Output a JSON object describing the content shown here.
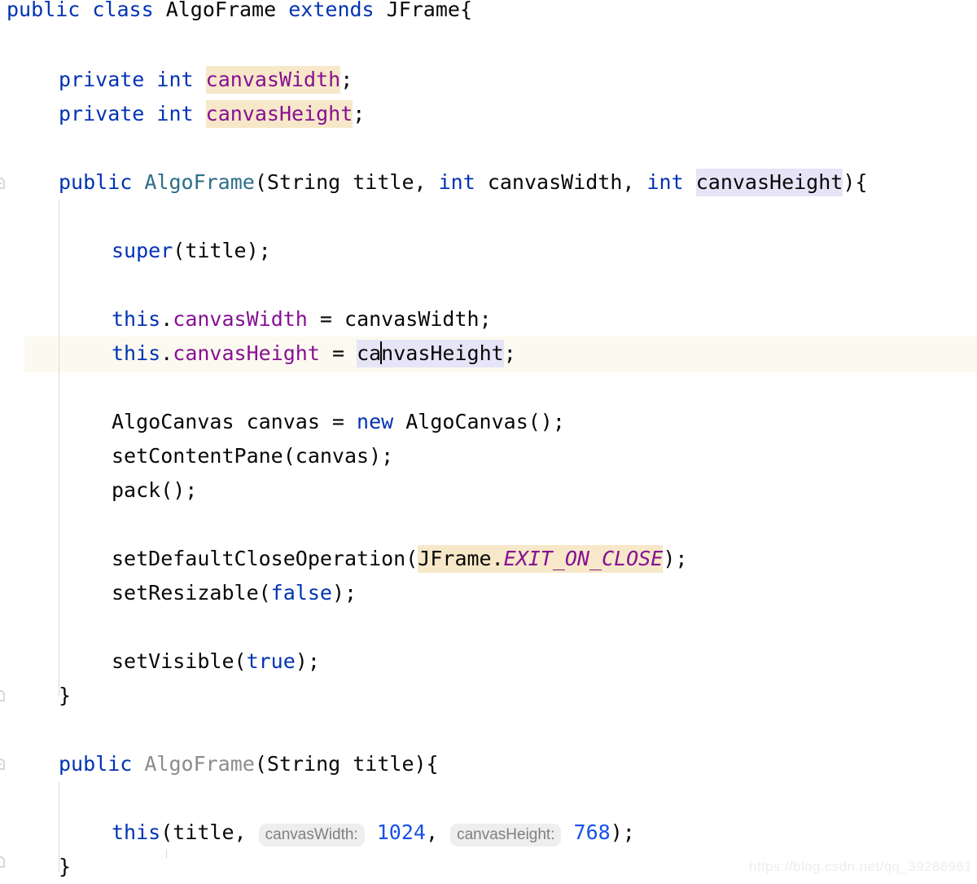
{
  "editor": {
    "app": "IntelliJ IDEA Java Editor",
    "file_language": "Java",
    "theme": "light"
  },
  "colors": {
    "background": "#ffffff",
    "keyword": "#0033b3",
    "field": "#871094",
    "number": "#1750eb",
    "constructor_used": "#2d6e8a",
    "constructor_unused": "#8c8c8c",
    "text": "#080808",
    "identifier_highlight": "#f6e8c8",
    "occurrence_highlight": "#e6e4f7",
    "current_line": "#fcfaf0",
    "indent_guide": "#d9d9d9",
    "hint_background": "#eeeeee",
    "hint_text": "#808080",
    "watermark": "#ededed"
  },
  "code": {
    "line01": {
      "kw_public": "public",
      "kw_class": "class",
      "class_name": "AlgoFrame",
      "kw_extends": "extends",
      "super_class": "JFrame{"
    },
    "line03": {
      "kw_private": "private",
      "kw_int": "int",
      "field": "canvasWidth",
      "semi": ";"
    },
    "line04": {
      "kw_private": "private",
      "kw_int": "int",
      "field": "canvasHeight",
      "semi": ";"
    },
    "line06": {
      "kw_public": "public",
      "ctor_name": "AlgoFrame",
      "open_paren": "(String title, ",
      "kw_int_1": "int",
      "param_1": " canvasWidth, ",
      "kw_int_2": "int",
      "space": " ",
      "param_2": "canvasHeight",
      "close": "){"
    },
    "line08": {
      "kw_super": "super",
      "rest": "(title);"
    },
    "line10": {
      "kw_this": "this",
      "dot": ".",
      "field": "canvasWidth",
      "assign": " = canvasWidth;"
    },
    "line11": {
      "kw_this": "this",
      "dot": ".",
      "field": "canvasHeight",
      "assign_eq": " = ",
      "rhs_before_caret": "ca",
      "rhs_after_caret": "nvasHeight",
      "semi": ";"
    },
    "line13": {
      "before_new": "AlgoCanvas canvas = ",
      "kw_new": "new",
      "after_new": " AlgoCanvas();"
    },
    "line14": {
      "text": "setContentPane(canvas);"
    },
    "line15": {
      "text": "pack();"
    },
    "line17": {
      "call": "setDefaultCloseOperation(",
      "qualifier": "JFrame.",
      "constant": "EXIT_ON_CLOSE",
      "close": ");"
    },
    "line18": {
      "call": "setResizable(",
      "kw_false": "false",
      "close": ");"
    },
    "line20": {
      "call": "setVisible(",
      "kw_true": "true",
      "close": ");"
    },
    "line21": {
      "text": "}"
    },
    "line23": {
      "kw_public": "public",
      "ctor_name": "AlgoFrame",
      "rest": "(String title){"
    },
    "line25": {
      "kw_this": "this",
      "open": "(title, ",
      "hint_1": "canvasWidth:",
      "num_1": "1024",
      "comma": ", ",
      "hint_2": "canvasHeight:",
      "num_2": "768",
      "close": ");"
    },
    "line26": {
      "text": "}"
    }
  },
  "watermark": {
    "text": "https://blog.csdn.net/qq_39288961"
  }
}
